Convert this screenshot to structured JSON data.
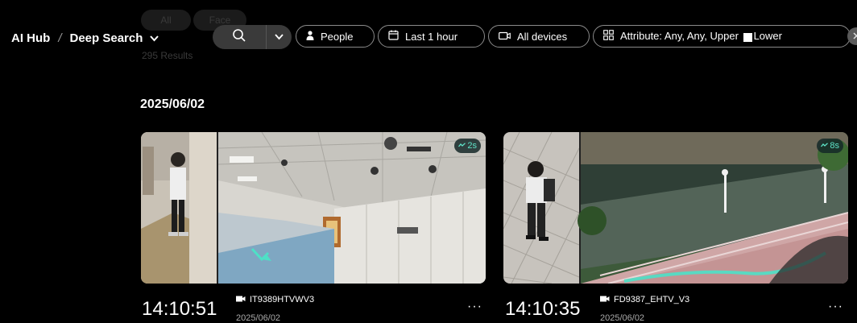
{
  "ghost": {
    "tab_all": "All",
    "tab_face": "Face",
    "results": "295 Results"
  },
  "breadcrumb": {
    "root": "AI Hub",
    "separator": "/",
    "current": "Deep Search",
    "chevron_icon": "chevron-down-icon"
  },
  "search": {
    "search_icon": "search-icon",
    "dropdown_icon": "chevron-down-icon"
  },
  "filters": {
    "people": {
      "label": "People",
      "icon": "person-icon"
    },
    "time": {
      "label": "Last 1 hour",
      "icon": "calendar-icon"
    },
    "devices": {
      "label": "All devices",
      "icon": "camera-icon"
    },
    "attribute": {
      "label": "Attribute: Any, Any, Upper",
      "lower_label": "Lower",
      "icon": "grid-icon",
      "upper_color": "#ffffff",
      "lower_color": "#000000"
    },
    "close_icon": "close-icon"
  },
  "date_heading": "2025/06/02",
  "results": [
    {
      "time": "14:10:51",
      "device": "IT9389HTVWV3",
      "date": "2025/06/02",
      "duration": "2s",
      "more": "···"
    },
    {
      "time": "14:10:35",
      "device": "FD9387_EHTV_V3",
      "date": "2025/06/02",
      "duration": "8s",
      "more": "···"
    }
  ],
  "colors": {
    "background": "#000000",
    "chip_border": "#8a8a8a",
    "accent": "#5fe3c8"
  }
}
